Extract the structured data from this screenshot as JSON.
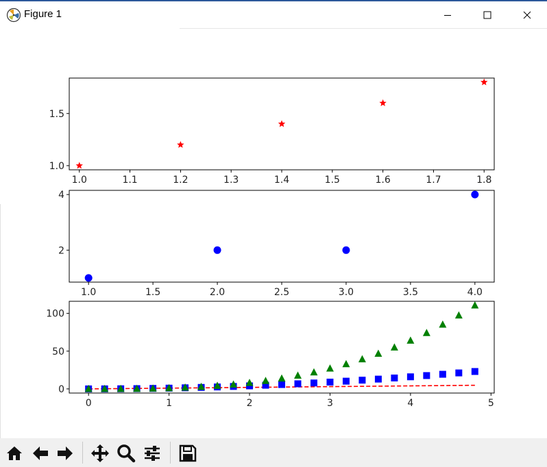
{
  "window": {
    "title": "Figure 1"
  },
  "toolbar": {
    "buttons": [
      {
        "name": "home-icon",
        "tooltip": "Home"
      },
      {
        "name": "back-icon",
        "tooltip": "Back"
      },
      {
        "name": "forward-icon",
        "tooltip": "Forward"
      },
      {
        "name": "pan-icon",
        "tooltip": "Pan"
      },
      {
        "name": "zoom-icon",
        "tooltip": "Zoom"
      },
      {
        "name": "subplots-icon",
        "tooltip": "Configure subplots"
      },
      {
        "name": "save-icon",
        "tooltip": "Save"
      }
    ]
  },
  "chart_data": [
    {
      "type": "scatter",
      "xlim": [
        0.98,
        1.82
      ],
      "ylim": [
        0.96,
        1.84
      ],
      "xticks": [
        1.0,
        1.1,
        1.2,
        1.3,
        1.4,
        1.5,
        1.6,
        1.7,
        1.8
      ],
      "xtick_labels": [
        "1.0",
        "1.1",
        "1.2",
        "1.3",
        "1.4",
        "1.5",
        "1.6",
        "1.7",
        "1.8"
      ],
      "yticks": [
        1.0,
        1.5
      ],
      "ytick_labels": [
        "1.0",
        "1.5"
      ],
      "series": [
        {
          "marker": "star",
          "color": "#ff0000",
          "x": [
            1.0,
            1.2,
            1.4,
            1.6,
            1.8
          ],
          "y": [
            1.0,
            1.2,
            1.4,
            1.6,
            1.8
          ]
        }
      ]
    },
    {
      "type": "scatter",
      "xlim": [
        0.85,
        4.15
      ],
      "ylim": [
        0.85,
        4.15
      ],
      "xticks": [
        1.0,
        1.5,
        2.0,
        2.5,
        3.0,
        3.5,
        4.0
      ],
      "xtick_labels": [
        "1.0",
        "1.5",
        "2.0",
        "2.5",
        "3.0",
        "3.5",
        "4.0"
      ],
      "yticks": [
        2,
        4
      ],
      "ytick_labels": [
        "2",
        "4"
      ],
      "series": [
        {
          "marker": "circle",
          "color": "#0000ff",
          "x": [
            1,
            2,
            3,
            4
          ],
          "y": [
            1,
            2,
            2,
            4
          ]
        }
      ]
    },
    {
      "type": "line",
      "xlim": [
        -0.24,
        5.04
      ],
      "ylim": [
        -5.5,
        116
      ],
      "xticks": [
        0,
        1,
        2,
        3,
        4,
        5
      ],
      "xtick_labels": [
        "0",
        "1",
        "2",
        "3",
        "4",
        "5"
      ],
      "yticks": [
        0,
        50,
        100
      ],
      "ytick_labels": [
        "0",
        "50",
        "100"
      ],
      "x": [
        0.0,
        0.2,
        0.4,
        0.6,
        0.8,
        1.0,
        1.2,
        1.4,
        1.6,
        1.8,
        2.0,
        2.2,
        2.4,
        2.6,
        2.8,
        3.0,
        3.2,
        3.4,
        3.6,
        3.8,
        4.0,
        4.2,
        4.4,
        4.6,
        4.8
      ],
      "series": [
        {
          "style": "dashed-line",
          "color": "#ff0000",
          "expr": "t",
          "values": [
            0.0,
            0.2,
            0.4,
            0.6,
            0.8,
            1.0,
            1.2,
            1.4,
            1.6,
            1.8,
            2.0,
            2.2,
            2.4,
            2.6,
            2.8,
            3.0,
            3.2,
            3.4,
            3.6,
            3.8,
            4.0,
            4.2,
            4.4,
            4.6,
            4.8
          ]
        },
        {
          "style": "square",
          "color": "#0000ff",
          "expr": "t^2",
          "values": [
            0.0,
            0.04,
            0.16,
            0.36,
            0.64,
            1.0,
            1.44,
            1.96,
            2.56,
            3.24,
            4.0,
            4.84,
            5.76,
            6.76,
            7.84,
            9.0,
            10.24,
            11.56,
            12.96,
            14.44,
            16.0,
            17.64,
            19.36,
            21.16,
            23.04
          ]
        },
        {
          "style": "triangle",
          "color": "#008000",
          "expr": "t^3",
          "values": [
            0.0,
            0.008,
            0.064,
            0.216,
            0.512,
            1.0,
            1.728,
            2.744,
            4.096,
            5.832,
            8.0,
            10.648,
            13.824,
            17.576,
            21.952,
            27.0,
            32.768,
            39.304,
            46.656,
            54.872,
            64.0,
            74.088,
            85.184,
            97.336,
            110.592
          ]
        }
      ]
    }
  ]
}
